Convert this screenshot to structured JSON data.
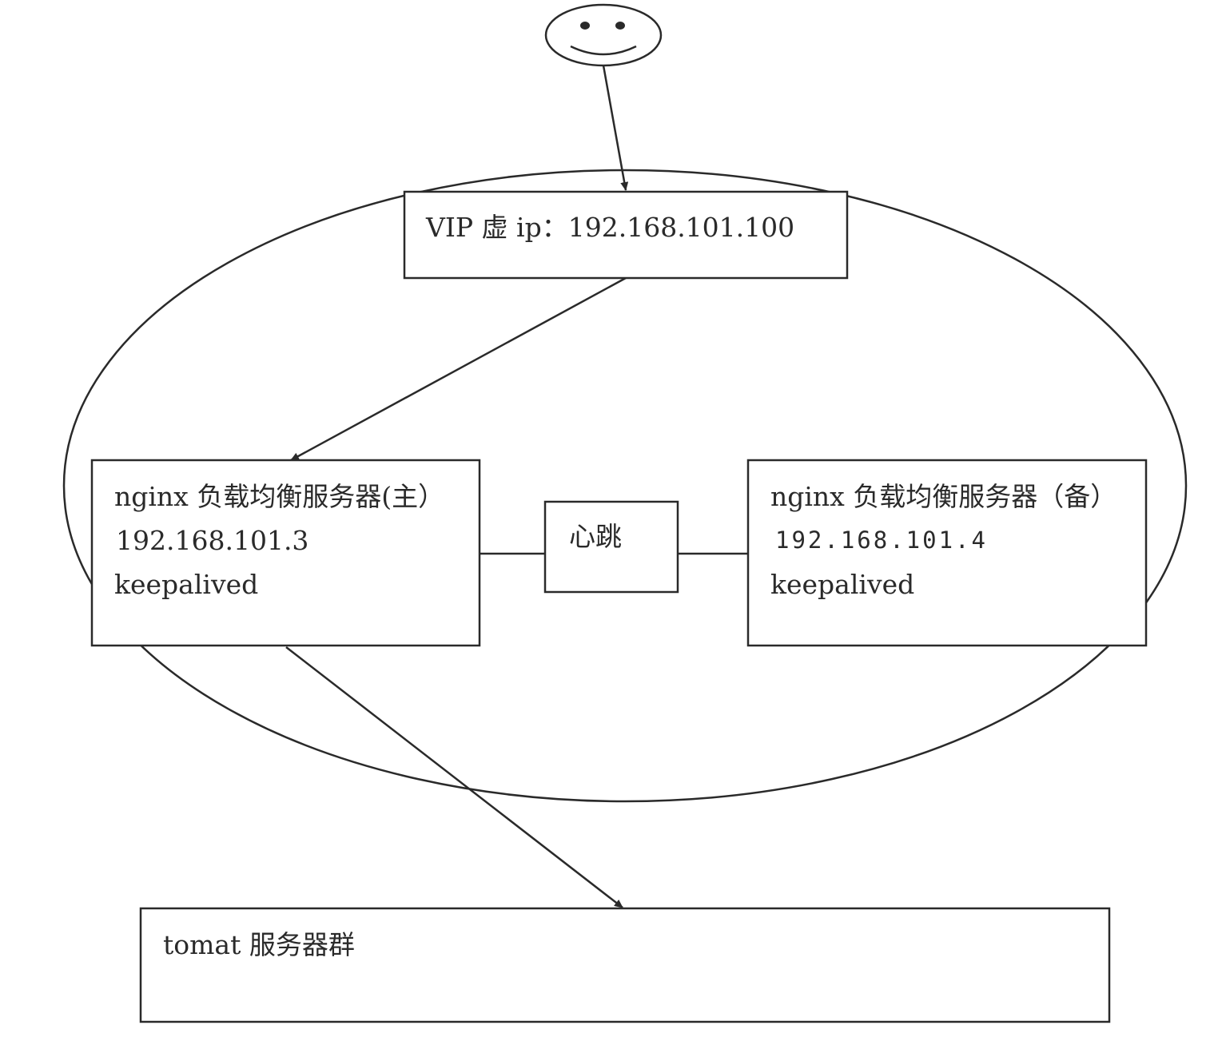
{
  "nodes": {
    "vip": {
      "label": "VIP 虚 ip：192.168.101.100"
    },
    "master": {
      "title": "nginx 负载均衡服务器(主）",
      "ip": "192.168.101.3",
      "software": "keepalived"
    },
    "heartbeat": {
      "label": "心跳"
    },
    "backup": {
      "title": "nginx 负载均衡服务器（备）",
      "ip": "192.168.101.4",
      "software": "keepalived"
    },
    "tomcat": {
      "label": "tomat 服务器群"
    }
  },
  "icons": {
    "user": "smiley-face-icon"
  },
  "edges": [
    {
      "from": "user",
      "to": "vip",
      "type": "arrow"
    },
    {
      "from": "vip",
      "to": "master",
      "type": "arrow"
    },
    {
      "from": "master",
      "to": "heartbeat",
      "type": "line"
    },
    {
      "from": "heartbeat",
      "to": "backup",
      "type": "line"
    },
    {
      "from": "master",
      "to": "tomcat",
      "type": "arrow"
    }
  ],
  "colors": {
    "stroke": "#2a2a2a",
    "background": "#ffffff"
  }
}
